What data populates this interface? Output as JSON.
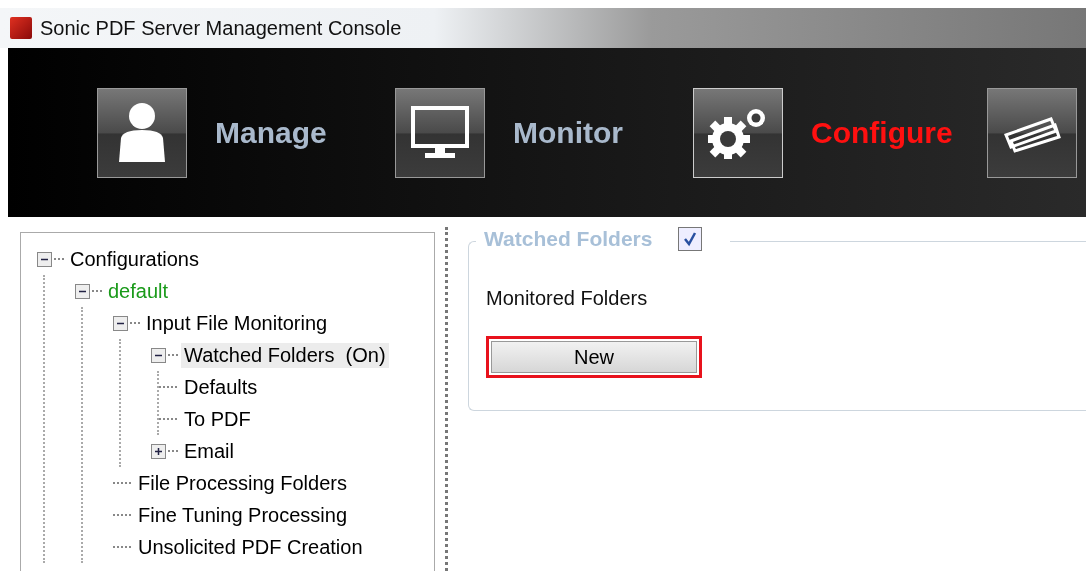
{
  "window": {
    "title": "Sonic PDF Server Management Console"
  },
  "nav": [
    {
      "label": "Manage",
      "selected": false
    },
    {
      "label": "Monitor",
      "selected": false
    },
    {
      "label": "Configure",
      "selected": true
    },
    {
      "selected": false
    }
  ],
  "tree": [
    {
      "label": "Configurations",
      "color": "#000000",
      "expanded": true,
      "selected": false,
      "children": [
        {
          "label": "default",
          "color": "#1a9a1a",
          "expanded": true,
          "selected": false,
          "children": [
            {
              "label": "Input File Monitoring",
              "color": "#000000",
              "expanded": true,
              "selected": false,
              "children": [
                {
                  "label": "Watched Folders  (On)",
                  "color": "#000000",
                  "expanded": true,
                  "selected": true,
                  "children": [
                    {
                      "label": "Defaults",
                      "color": "#000000",
                      "selected": false
                    },
                    {
                      "label": "To PDF",
                      "color": "#000000",
                      "selected": false
                    }
                  ]
                },
                {
                  "label": "Email",
                  "color": "#000000",
                  "expanded": false,
                  "selected": false
                }
              ]
            },
            {
              "label": "File Processing Folders",
              "color": "#000000",
              "selected": false
            },
            {
              "label": "Fine Tuning Processing",
              "color": "#000000",
              "selected": false
            },
            {
              "label": "Unsolicited PDF Creation",
              "color": "#000000",
              "selected": false
            }
          ]
        }
      ]
    }
  ],
  "group": {
    "title": "Watched Folders",
    "checked": true,
    "label": "Monitored Folders",
    "button": {
      "label": "New",
      "highlighted": true
    }
  }
}
